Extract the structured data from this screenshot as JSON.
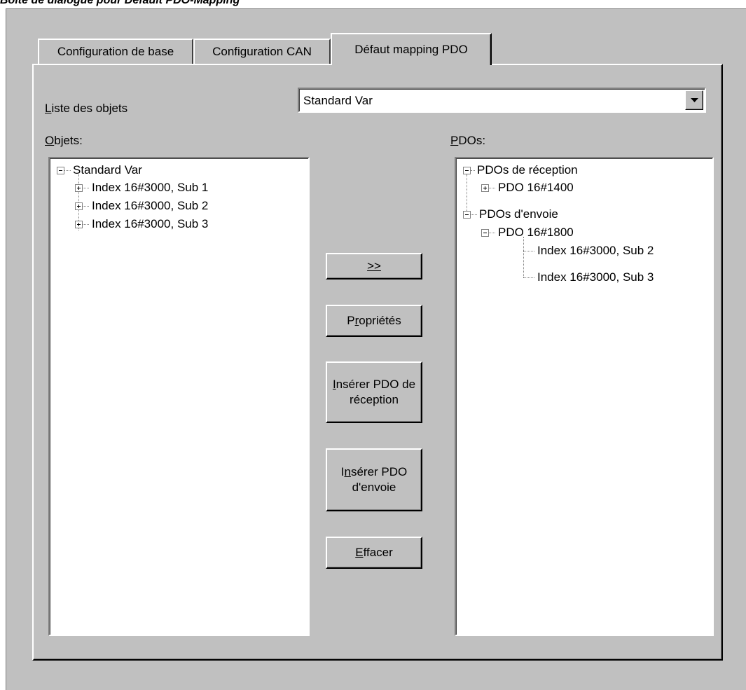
{
  "caption": "Boîte de dialogue pour Défault PDO-Mapping",
  "tabs": [
    {
      "label": "Configuration de base",
      "active": false
    },
    {
      "label": "Configuration CAN",
      "active": false
    },
    {
      "label": "Défaut mapping PDO",
      "active": true
    }
  ],
  "object_list": {
    "label_first": "L",
    "label_rest": "iste des objets",
    "selected": "Standard Var"
  },
  "objects_panel": {
    "label_first": "O",
    "label_rest": "bjets:",
    "tree": [
      {
        "text": "Standard Var",
        "level": 0,
        "expanded": true
      },
      {
        "text": "Index 16#3000, Sub 1",
        "level": 1,
        "expanded": false
      },
      {
        "text": "Index 16#3000, Sub 2",
        "level": 1,
        "expanded": false
      },
      {
        "text": "Index 16#3000, Sub 3",
        "level": 1,
        "expanded": false
      }
    ]
  },
  "pdos_panel": {
    "label_first": "P",
    "label_rest": "DOs:",
    "tree": [
      {
        "text": "PDOs de réception",
        "level": 0,
        "expanded": true
      },
      {
        "text": "PDO 16#1400",
        "level": 1,
        "expanded": false
      },
      {
        "text": "PDOs d'envoie",
        "level": 0,
        "expanded": true
      },
      {
        "text": "PDO 16#1800",
        "level": 1,
        "expanded": true
      },
      {
        "text": "Index 16#3000, Sub 2",
        "level": 2,
        "expanded": null
      },
      {
        "text": "Index 16#3000, Sub 3",
        "level": 2,
        "expanded": null
      }
    ]
  },
  "buttons": {
    "move": {
      "u": ">>",
      "rest": ""
    },
    "properties": {
      "pre": "P",
      "u": "r",
      "rest": "opriétés"
    },
    "insert_rx": {
      "u": "I",
      "rest": "nsérer PDO de",
      "line2": "réception"
    },
    "insert_tx": {
      "pre": "I",
      "u": "n",
      "rest": "sérer PDO",
      "line2": "d'envoie"
    },
    "delete": {
      "u": "E",
      "rest": "ffacer"
    }
  },
  "icons": {
    "dropdown": "triangle-down-icon",
    "expand": "plus-box-icon",
    "collapse": "minus-box-icon"
  }
}
